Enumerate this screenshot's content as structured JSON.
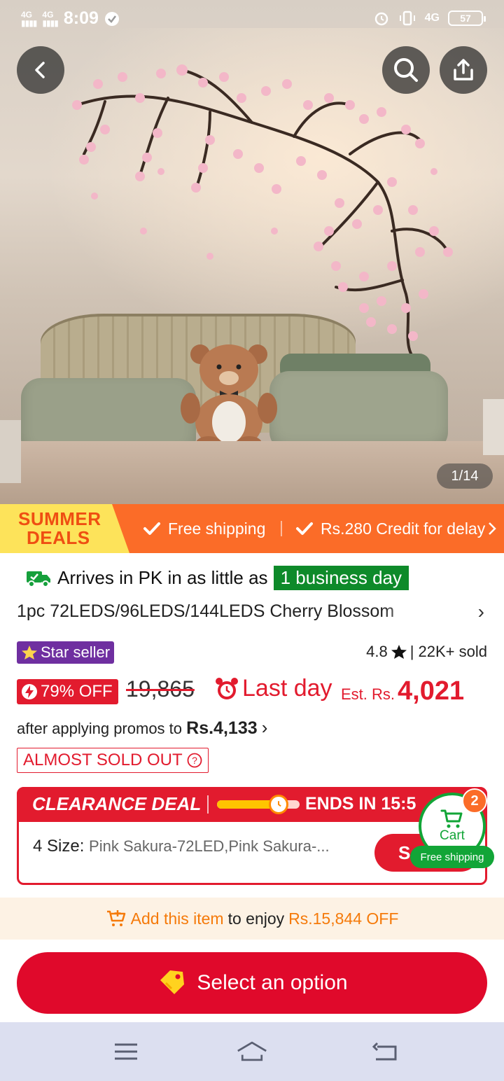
{
  "status_bar": {
    "time": "8:09",
    "network_left_1": "4G",
    "network_left_2": "4G",
    "network_right": "4G",
    "battery": "57"
  },
  "gallery": {
    "page_indicator": "1/14",
    "icons": [
      "back-icon",
      "search-icon",
      "share-icon"
    ]
  },
  "summer_deals": {
    "badge_line1": "SUMMER",
    "badge_line2": "DEALS",
    "benefit1": "Free shipping",
    "benefit2": "Rs.280 Credit for delay"
  },
  "product": {
    "arrival_prefix": "Arrives in PK in as little as",
    "arrival_highlight": "1 business day",
    "title": "1pc 72LEDS/96LEDS/144LEDS Cherry Blossom",
    "star_seller": "Star seller",
    "rating": "4.8",
    "sold": "| 22K+ sold",
    "discount": "79% OFF",
    "original_price": "19,865",
    "last_day": "Last day",
    "est_label": "Est. Rs.",
    "est_price": "4,021",
    "promo_prefix": "after applying promos to",
    "promo_price": "Rs.4,133",
    "stock_badge": "ALMOST SOLD OUT"
  },
  "clearance": {
    "title": "CLEARANCE DEAL",
    "ends_label": "ENDS IN",
    "countdown": "15:5",
    "progress_fraction": 0.75,
    "size_label": "4 Size:",
    "size_value": "Pink Sakura-72LED,Pink Sakura-...",
    "select_label": "S"
  },
  "cart": {
    "count": "2",
    "label": "Cart",
    "free_shipping": "Free shipping"
  },
  "add_strip": {
    "link": "Add this item",
    "middle": "to enjoy",
    "amount": "Rs.15,844 OFF"
  },
  "cta": {
    "label": "Select an option"
  },
  "colors": {
    "brand_red": "#e21b2e",
    "deals_orange": "#fb6c28",
    "deals_yellow": "#fde35a",
    "green": "#12a537",
    "star_purple": "#6f2fa0"
  }
}
